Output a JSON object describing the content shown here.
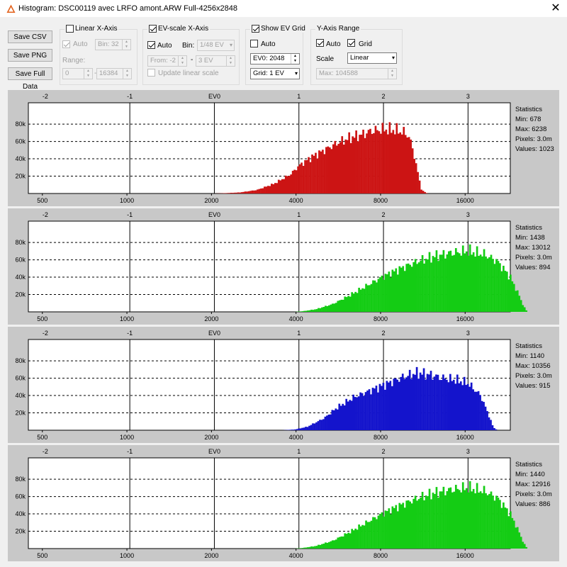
{
  "window": {
    "title": "Histogram: DSC00119 avec LRFO amont.ARW Full-4256x2848",
    "close_glyph": "✕"
  },
  "toolbar": {
    "save_csv": "Save CSV",
    "save_png": "Save PNG",
    "save_full": "Save Full Data"
  },
  "linear_axis": {
    "label": "Linear X-Axis",
    "checked": false,
    "auto_label": "Auto",
    "auto_checked": true,
    "bin_label": "Bin:",
    "bin_value": "32",
    "range_label": "Range:",
    "range_from": "0",
    "range_sep": "-",
    "range_to": "16384"
  },
  "ev_axis": {
    "label": "EV-scale X-Axis",
    "checked": true,
    "auto_label": "Auto",
    "auto_checked": true,
    "bin_label": "Bin:",
    "bin_value": "1/48 EV",
    "from_label": "From:",
    "from_value": "-2",
    "sep": "-",
    "to_value": "3 EV",
    "update_label": "Update linear scale",
    "update_checked": false
  },
  "ev_grid": {
    "label": "Show EV Grid",
    "checked": true,
    "auto_label": "Auto",
    "auto_checked": false,
    "ev0_value": "EV0: 2048",
    "grid_value": "Grid: 1 EV"
  },
  "y_range": {
    "label": "Y-Axis Range",
    "auto_label": "Auto",
    "auto_checked": true,
    "grid_label": "Grid",
    "grid_checked": true,
    "scale_label": "Scale",
    "scale_value": "Linear",
    "max_value": "Max: 104588"
  },
  "axes": {
    "ev_ticks": [
      "-2",
      "-1",
      "EV0",
      "1",
      "2",
      "3"
    ],
    "linear_ticks": [
      "500",
      "1000",
      "2000",
      "4000",
      "8000",
      "16000"
    ],
    "y_ticks": [
      "80k",
      "60k",
      "40k",
      "20k"
    ]
  },
  "stats_labels": {
    "title": "Statistics",
    "min": "Min:",
    "max": "Max:",
    "pixels": "Pixels:",
    "values": "Values:"
  },
  "chart_data": [
    {
      "type": "bar",
      "channel": "red",
      "color": "#cc1414",
      "ylim": [
        0,
        104588
      ],
      "xlim_ev": [
        -2.2,
        3.5
      ],
      "stats": {
        "min": "678",
        "max": "6238",
        "pixels": "3.0m",
        "values": "1023"
      },
      "ev_points": [
        [
          0.0,
          0
        ],
        [
          0.1,
          300
        ],
        [
          0.3,
          1200
        ],
        [
          0.5,
          4000
        ],
        [
          0.7,
          11000
        ],
        [
          0.9,
          22000
        ],
        [
          1.0,
          32000
        ],
        [
          1.15,
          42000
        ],
        [
          1.3,
          50000
        ],
        [
          1.45,
          58000
        ],
        [
          1.6,
          64000
        ],
        [
          1.75,
          68000
        ],
        [
          1.85,
          72000
        ],
        [
          2.0,
          74000
        ],
        [
          2.15,
          73000
        ],
        [
          2.25,
          70000
        ],
        [
          2.3,
          66000
        ],
        [
          2.35,
          50000
        ],
        [
          2.45,
          4000
        ],
        [
          2.52,
          0
        ]
      ]
    },
    {
      "type": "bar",
      "channel": "green",
      "color": "#14cc14",
      "ylim": [
        0,
        104588
      ],
      "xlim_ev": [
        -2.2,
        3.5
      ],
      "stats": {
        "min": "1438",
        "max": "13012",
        "pixels": "3.0m",
        "values": "894"
      },
      "ev_points": [
        [
          0.95,
          0
        ],
        [
          1.05,
          800
        ],
        [
          1.2,
          3000
        ],
        [
          1.4,
          9000
        ],
        [
          1.6,
          19000
        ],
        [
          1.8,
          30000
        ],
        [
          2.0,
          41000
        ],
        [
          2.2,
          50000
        ],
        [
          2.4,
          58000
        ],
        [
          2.6,
          64000
        ],
        [
          2.8,
          68000
        ],
        [
          3.0,
          70000
        ],
        [
          3.2,
          66000
        ],
        [
          3.35,
          58000
        ],
        [
          3.5,
          40000
        ],
        [
          3.6,
          20000
        ],
        [
          3.65,
          8000
        ],
        [
          3.7,
          0
        ]
      ]
    },
    {
      "type": "bar",
      "channel": "blue",
      "color": "#1414cc",
      "ylim": [
        0,
        104588
      ],
      "xlim_ev": [
        -2.2,
        3.5
      ],
      "stats": {
        "min": "1140",
        "max": "10356",
        "pixels": "3.0m",
        "values": "915"
      },
      "ev_points": [
        [
          0.8,
          0
        ],
        [
          0.95,
          800
        ],
        [
          1.1,
          4000
        ],
        [
          1.3,
          14000
        ],
        [
          1.45,
          26000
        ],
        [
          1.65,
          38000
        ],
        [
          1.85,
          46000
        ],
        [
          2.05,
          54000
        ],
        [
          2.25,
          62000
        ],
        [
          2.4,
          66000
        ],
        [
          2.55,
          64000
        ],
        [
          2.7,
          60000
        ],
        [
          2.85,
          58000
        ],
        [
          3.0,
          54000
        ],
        [
          3.15,
          40000
        ],
        [
          3.25,
          16000
        ],
        [
          3.3,
          3000
        ],
        [
          3.35,
          0
        ]
      ]
    },
    {
      "type": "bar",
      "channel": "green",
      "color": "#14cc14",
      "ylim": [
        0,
        104588
      ],
      "xlim_ev": [
        -2.2,
        3.5
      ],
      "stats": {
        "min": "1440",
        "max": "12916",
        "pixels": "3.0m",
        "values": "886"
      },
      "ev_points": [
        [
          0.95,
          0
        ],
        [
          1.05,
          800
        ],
        [
          1.2,
          3000
        ],
        [
          1.4,
          9000
        ],
        [
          1.6,
          19000
        ],
        [
          1.8,
          30000
        ],
        [
          2.0,
          41000
        ],
        [
          2.2,
          50000
        ],
        [
          2.4,
          58000
        ],
        [
          2.6,
          64000
        ],
        [
          2.8,
          68000
        ],
        [
          3.0,
          70000
        ],
        [
          3.2,
          66000
        ],
        [
          3.35,
          58000
        ],
        [
          3.5,
          40000
        ],
        [
          3.6,
          20000
        ],
        [
          3.65,
          8000
        ],
        [
          3.7,
          0
        ]
      ]
    }
  ]
}
